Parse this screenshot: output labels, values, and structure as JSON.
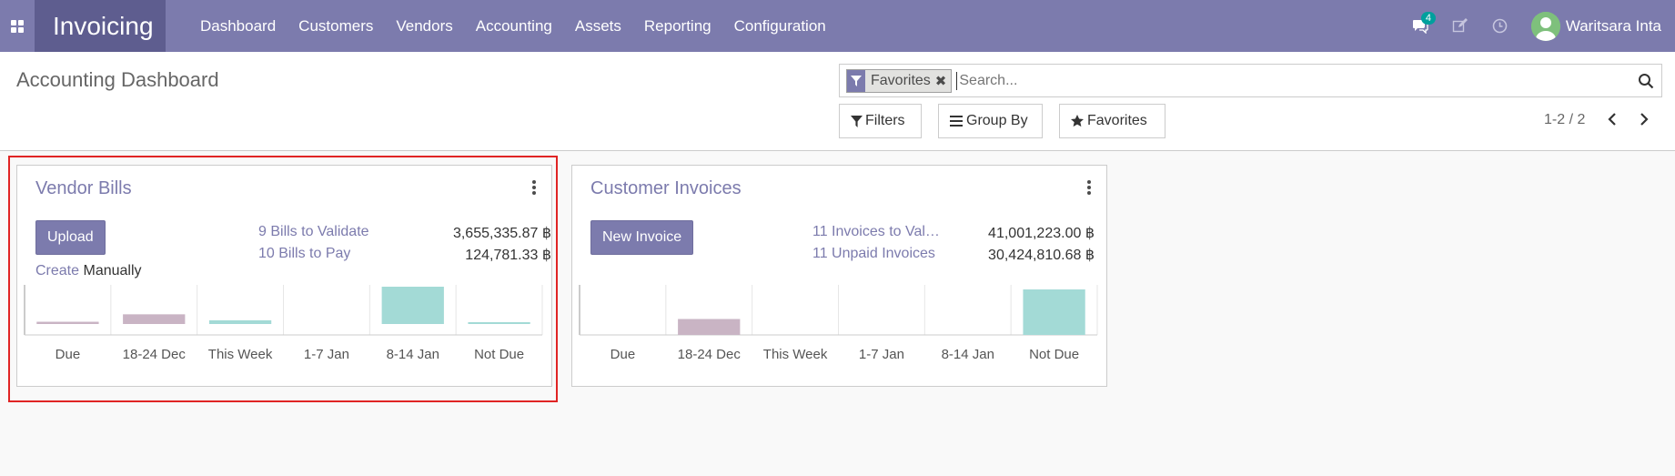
{
  "navbar": {
    "app_title": "Invoicing",
    "menu": [
      "Dashboard",
      "Customers",
      "Vendors",
      "Accounting",
      "Assets",
      "Reporting",
      "Configuration"
    ],
    "messages_count": "4",
    "user_name": "Waritsara Inta",
    "bg_color": "#7c7bad",
    "brand_color": "#5e5d8f"
  },
  "control_panel": {
    "title": "Accounting Dashboard",
    "facet_label": "Favorites",
    "search_placeholder": "Search...",
    "filters_label": "Filters",
    "groupby_label": "Group By",
    "favorites_label": "Favorites",
    "pager": "1-2 / 2"
  },
  "cards": [
    {
      "title": "Vendor Bills",
      "primary_button": "Upload",
      "create_link": "Create",
      "create_text": "Manually",
      "stats": [
        {
          "label": "9 Bills to Validate",
          "amount": "3,655,335.87 ฿"
        },
        {
          "label": "10 Bills to Pay",
          "amount": "124,781.33 ฿"
        }
      ],
      "chart_data": {
        "type": "bar",
        "categories": [
          "Due",
          "18-24 Dec",
          "This Week",
          "1-7 Jan",
          "8-14 Jan",
          "Not Due"
        ],
        "values": [
          0.06,
          0.26,
          0.1,
          0,
          1,
          0.02
        ],
        "bar_colors": [
          "#c9b4c4",
          "#c9b4c4",
          "#a3dad6",
          "#a3dad6",
          "#a3dad6",
          "#a3dad6"
        ],
        "baseline_offset": 0.3
      }
    },
    {
      "title": "Customer Invoices",
      "primary_button": "New Invoice",
      "stats": [
        {
          "label": "11 Invoices to Val…",
          "amount": "41,001,223.00 ฿"
        },
        {
          "label": "11 Unpaid Invoices",
          "amount": "30,424,810.68 ฿"
        }
      ],
      "chart_data": {
        "type": "bar",
        "categories": [
          "Due",
          "18-24 Dec",
          "This Week",
          "1-7 Jan",
          "8-14 Jan",
          "Not Due"
        ],
        "values": [
          0,
          0.35,
          0,
          0,
          0,
          1
        ],
        "bar_colors": [
          "#c9b4c4",
          "#c9b4c4",
          "#a3dad6",
          "#a3dad6",
          "#a3dad6",
          "#a3dad6"
        ],
        "baseline_offset": 0
      }
    }
  ]
}
